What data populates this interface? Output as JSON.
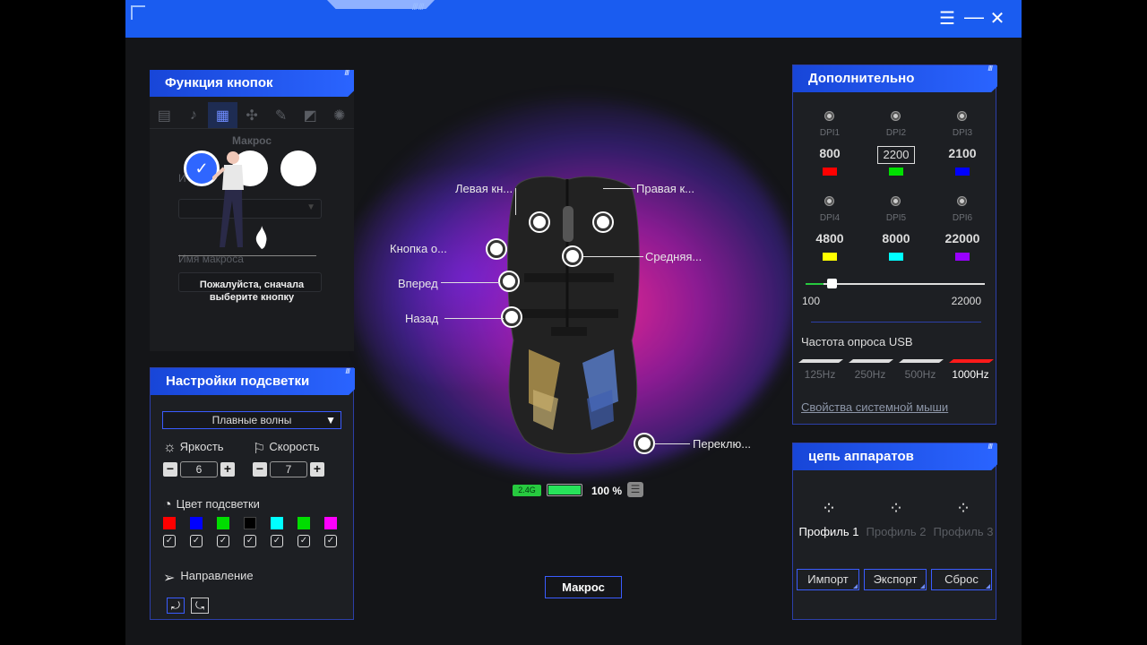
{
  "buttons_panel": {
    "title": "Функция кнопок",
    "mode_label": "Макрос",
    "macro_name_label": "Имя макроса",
    "hint_line1": "Пожалуйста, сначала",
    "hint_line2": "выберите кнопку"
  },
  "lighting": {
    "title": "Настройки подсветки",
    "effect": "Плавные волны",
    "brightness_label": "Яркость",
    "brightness_value": "6",
    "speed_label": "Скорость",
    "speed_value": "7",
    "color_label": "Цвет подсветки",
    "colors": [
      "#ff0000",
      "#0000ff",
      "#00dd00",
      "#000000",
      "#00ffff",
      "#00dd00",
      "#ff00ff"
    ],
    "direction_label": "Направление"
  },
  "mouse": {
    "left": "Левая кн...",
    "right": "Правая к...",
    "button_o": "Кнопка о...",
    "middle": "Средняя...",
    "forward": "Вперед",
    "back": "Назад",
    "switch": "Переклю...",
    "conn": "2.4G",
    "battery_pct": "100 %",
    "battery_level": 1.0,
    "macro_button": "Макрос"
  },
  "extra": {
    "title": "Дополнительно",
    "dpi": [
      {
        "label": "DPI1",
        "value": "800",
        "color": "#ff0000"
      },
      {
        "label": "DPI2",
        "value": "2200",
        "color": "#00e000"
      },
      {
        "label": "DPI3",
        "value": "2100",
        "color": "#0000ff"
      },
      {
        "label": "DPI4",
        "value": "4800",
        "color": "#ffff00"
      },
      {
        "label": "DPI5",
        "value": "8000",
        "color": "#00ffff"
      },
      {
        "label": "DPI6",
        "value": "22000",
        "color": "#9900ff"
      }
    ],
    "slider_min": "100",
    "slider_max": "22000",
    "poll_title": "Частота опроса USB",
    "poll_rates": [
      "125Hz",
      "250Hz",
      "500Hz",
      "1000Hz"
    ],
    "sys_mouse": "Свойства системной мыши"
  },
  "chain": {
    "title": "цепь аппаратов",
    "profiles": [
      "Профиль 1",
      "Профиль 2",
      "Профиль 3"
    ],
    "import": "Импорт",
    "export": "Экспорт",
    "reset": "Сброс"
  }
}
